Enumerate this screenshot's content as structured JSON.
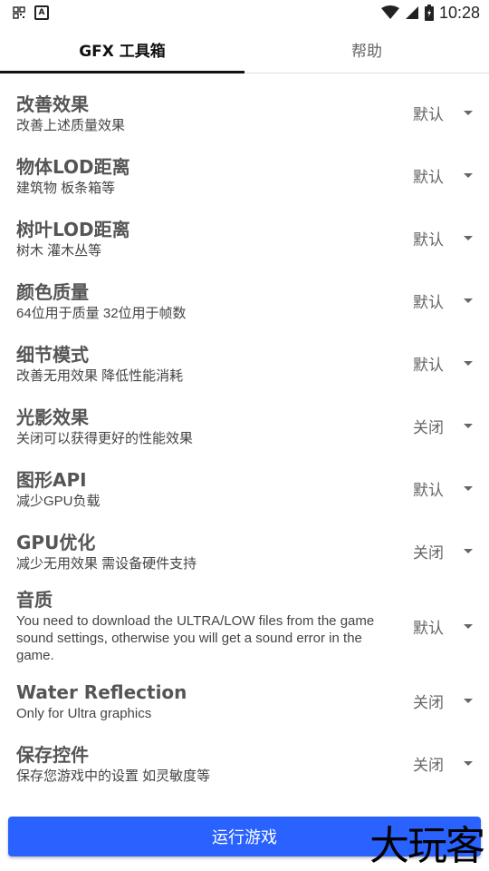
{
  "statusbar": {
    "time": "10:28",
    "left_icons": [
      "grid-icon",
      "a-letter-icon"
    ],
    "right_icons": [
      "wifi-icon",
      "signal-icon",
      "battery-icon"
    ]
  },
  "tabs": [
    {
      "label": "GFX 工具箱",
      "active": true
    },
    {
      "label": "帮助",
      "active": false
    }
  ],
  "settings": [
    {
      "title": "改善效果",
      "subtitle": "改善上述质量效果",
      "value": "默认"
    },
    {
      "title": "物体LOD距离",
      "subtitle": "建筑物 板条箱等",
      "value": "默认"
    },
    {
      "title": "树叶LOD距离",
      "subtitle": "树木 灌木丛等",
      "value": "默认"
    },
    {
      "title": "颜色质量",
      "subtitle": "64位用于质量 32位用于帧数",
      "value": "默认"
    },
    {
      "title": "细节模式",
      "subtitle": "改善无用效果 降低性能消耗",
      "value": "默认"
    },
    {
      "title": "光影效果",
      "subtitle": "关闭可以获得更好的性能效果",
      "value": "关闭"
    },
    {
      "title": "图形API",
      "subtitle": "减少GPU负载",
      "value": "默认"
    },
    {
      "title": "GPU优化",
      "subtitle": "减少无用效果 需设备硬件支持",
      "value": "关闭"
    },
    {
      "title": "音质",
      "subtitle": "You need to download the ULTRA/LOW files from the game sound settings, otherwise you will get a sound error in the game.",
      "value": "默认"
    },
    {
      "title": "Water Reflection",
      "subtitle": "Only for Ultra graphics",
      "value": "关闭"
    },
    {
      "title": "保存控件",
      "subtitle": "保存您游戏中的设置 如灵敏度等",
      "value": "关闭"
    }
  ],
  "run_button": {
    "label": "运行游戏",
    "color": "#2962ff"
  },
  "watermark": "大玩客"
}
